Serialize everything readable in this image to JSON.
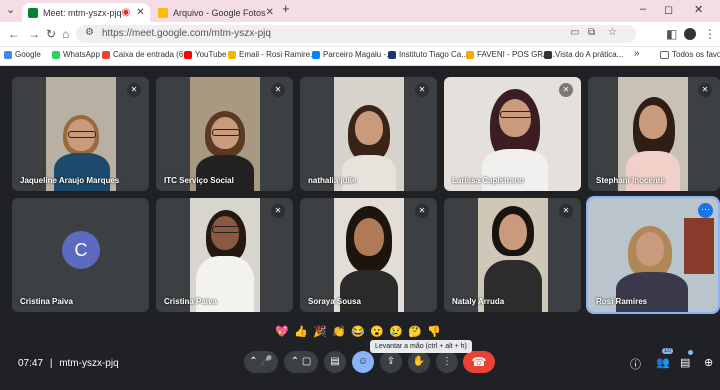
{
  "browser": {
    "tabs": [
      {
        "title": "Meet: mtm-yszx-pjq",
        "active": true
      },
      {
        "title": "Arquivo - Google Fotos",
        "active": false
      }
    ],
    "new_tab": "+",
    "url": "https://meet.google.com/mtm-yszx-pjq",
    "window_controls": [
      "–",
      "◻",
      "✕"
    ],
    "bookmarks": [
      {
        "label": "Google",
        "color": "#4285f4"
      },
      {
        "label": "WhatsApp",
        "color": "#25d366"
      },
      {
        "label": "Caixa de entrada (6...",
        "color": "#ea4335"
      },
      {
        "label": "YouTube",
        "color": "#ff0000"
      },
      {
        "label": "Email - Rosi Ramire...",
        "color": "#f4b400"
      },
      {
        "label": "Parceiro Magalu -...",
        "color": "#0086ff"
      },
      {
        "label": "Instituto Tiago Ca...",
        "color": "#1b3a6b"
      },
      {
        "label": "FAVENI - POS GRA...",
        "color": "#f6a800"
      },
      {
        "label": "Vista do A prática...",
        "color": "#333333"
      }
    ],
    "bookmarks_more": "»",
    "all_favorites": "Todos os favoritos"
  },
  "participants": [
    {
      "name": "Jaqueline Araujo Marques",
      "muted": true
    },
    {
      "name": "ITC Serviço Social",
      "muted": true
    },
    {
      "name": "nathalia julie",
      "muted": true
    },
    {
      "name": "Larissa Capistrano",
      "muted": true
    },
    {
      "name": "Stephani Inocente",
      "muted": true
    },
    {
      "name": "Cristina Paiva",
      "muted": false,
      "avatar_letter": "C"
    },
    {
      "name": "Cristina Paiva",
      "muted": true
    },
    {
      "name": "Soraya Sousa",
      "muted": true
    },
    {
      "name": "Nataly Arruda",
      "muted": true
    },
    {
      "name": "Rosi Ramires",
      "muted": false
    }
  ],
  "reactions": [
    "💖",
    "👍",
    "🎉",
    "👏",
    "😂",
    "😮",
    "😢",
    "🤔",
    "👎"
  ],
  "controls": {
    "time": "07:47",
    "separator": "|",
    "meeting_code": "mtm-yszx-pjq",
    "tooltip": "Levantar a mão (ctrl + alt + h)",
    "participant_count": "10"
  },
  "colors": {
    "accent": "#8ab4f8",
    "hangup": "#ea4335",
    "avatar": "#5c6bc0"
  }
}
